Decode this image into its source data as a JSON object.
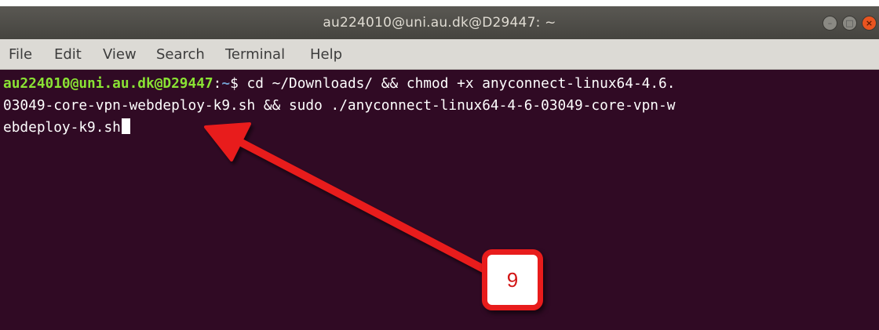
{
  "window": {
    "title": "au224010@uni.au.dk@D29447: ~"
  },
  "menubar": {
    "items": [
      "File",
      "Edit",
      "View",
      "Search",
      "Terminal",
      "Help"
    ]
  },
  "terminal": {
    "prompt_user": "au224010@uni.au.dk@D29447",
    "prompt_sep": ":",
    "prompt_path": "~",
    "prompt_symbol": "$ ",
    "command_line1": "cd ~/Downloads/ && chmod +x anyconnect-linux64-4.6.",
    "command_line2": "03049-core-vpn-webdeploy-k9.sh && sudo ./anyconnect-linux64-4-6-03049-core-vpn-w",
    "command_line3": "ebdeploy-k9.sh"
  },
  "annotation": {
    "step_number": "9",
    "color": "#e81c1c"
  },
  "colors": {
    "terminal_bg": "#300a24",
    "prompt_user": "#8ae234",
    "prompt_path": "#729fcf",
    "close_button": "#e95420"
  }
}
